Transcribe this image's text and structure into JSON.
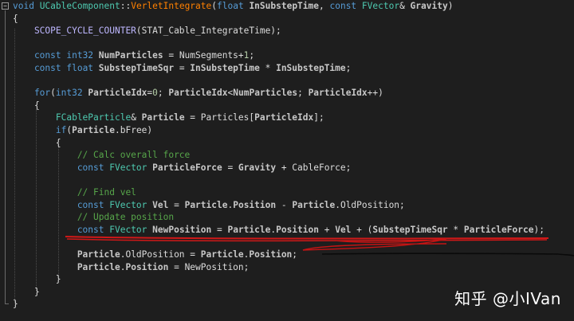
{
  "lines": [
    [
      {
        "t": "void ",
        "c": "kw"
      },
      {
        "t": "UCableComponent",
        "c": "ty"
      },
      {
        "t": "::",
        "c": "pl"
      },
      {
        "t": "VerletIntegrate",
        "c": "fn"
      },
      {
        "t": "(",
        "c": "pl"
      },
      {
        "t": "float ",
        "c": "kw"
      },
      {
        "t": "InSubstepTime",
        "c": "b"
      },
      {
        "t": ", ",
        "c": "pl"
      },
      {
        "t": "const ",
        "c": "kw"
      },
      {
        "t": "FVector",
        "c": "ty"
      },
      {
        "t": "& ",
        "c": "pl"
      },
      {
        "t": "Gravity",
        "c": "b"
      },
      {
        "t": ")",
        "c": "pl"
      }
    ],
    [
      {
        "t": "{",
        "c": "pl"
      }
    ],
    [
      {
        "t": "    SCOPE_CYCLE_COUNTER",
        "c": "mac"
      },
      {
        "t": "(STAT_Cable_IntegrateTime);",
        "c": "pl"
      }
    ],
    [],
    [
      {
        "t": "    const ",
        "c": "kw"
      },
      {
        "t": "int32 ",
        "c": "kw"
      },
      {
        "t": "NumParticles",
        "c": "b"
      },
      {
        "t": " = NumSegments+",
        "c": "pl"
      },
      {
        "t": "1",
        "c": "num"
      },
      {
        "t": ";",
        "c": "pl"
      }
    ],
    [
      {
        "t": "    const ",
        "c": "kw"
      },
      {
        "t": "float ",
        "c": "kw"
      },
      {
        "t": "SubstepTimeSqr",
        "c": "b"
      },
      {
        "t": " = ",
        "c": "pl"
      },
      {
        "t": "InSubstepTime",
        "c": "b"
      },
      {
        "t": " * ",
        "c": "pl"
      },
      {
        "t": "InSubstepTime",
        "c": "b"
      },
      {
        "t": ";",
        "c": "pl"
      }
    ],
    [],
    [
      {
        "t": "    for",
        "c": "kw"
      },
      {
        "t": "(",
        "c": "pl"
      },
      {
        "t": "int32 ",
        "c": "kw"
      },
      {
        "t": "ParticleIdx",
        "c": "b"
      },
      {
        "t": "=",
        "c": "pl"
      },
      {
        "t": "0",
        "c": "num"
      },
      {
        "t": "; ",
        "c": "pl"
      },
      {
        "t": "ParticleIdx",
        "c": "b"
      },
      {
        "t": "<",
        "c": "pl"
      },
      {
        "t": "NumParticles",
        "c": "b"
      },
      {
        "t": "; ",
        "c": "pl"
      },
      {
        "t": "ParticleIdx",
        "c": "b"
      },
      {
        "t": "++)",
        "c": "pl"
      }
    ],
    [
      {
        "t": "    {",
        "c": "pl"
      }
    ],
    [
      {
        "t": "        FCableParticle",
        "c": "ty"
      },
      {
        "t": "& ",
        "c": "pl"
      },
      {
        "t": "Particle",
        "c": "b"
      },
      {
        "t": " = Particles[",
        "c": "pl"
      },
      {
        "t": "ParticleIdx",
        "c": "b"
      },
      {
        "t": "];",
        "c": "pl"
      }
    ],
    [
      {
        "t": "        if",
        "c": "kw"
      },
      {
        "t": "(",
        "c": "pl"
      },
      {
        "t": "Particle",
        "c": "b"
      },
      {
        "t": ".bFree)",
        "c": "pl"
      }
    ],
    [
      {
        "t": "        {",
        "c": "pl"
      }
    ],
    [
      {
        "t": "            // Calc overall force",
        "c": "cm"
      }
    ],
    [
      {
        "t": "            const ",
        "c": "kw"
      },
      {
        "t": "FVector ",
        "c": "ty"
      },
      {
        "t": "ParticleForce",
        "c": "b"
      },
      {
        "t": " = ",
        "c": "pl"
      },
      {
        "t": "Gravity",
        "c": "b"
      },
      {
        "t": " + CableForce;",
        "c": "pl"
      }
    ],
    [],
    [
      {
        "t": "            // Find vel",
        "c": "cm"
      }
    ],
    [
      {
        "t": "            const ",
        "c": "kw"
      },
      {
        "t": "FVector ",
        "c": "ty"
      },
      {
        "t": "Vel",
        "c": "b"
      },
      {
        "t": " = ",
        "c": "pl"
      },
      {
        "t": "Particle",
        "c": "b"
      },
      {
        "t": ".",
        "c": "pl"
      },
      {
        "t": "Position",
        "c": "b"
      },
      {
        "t": " - ",
        "c": "pl"
      },
      {
        "t": "Particle",
        "c": "b"
      },
      {
        "t": ".OldPosition;",
        "c": "pl"
      }
    ],
    [
      {
        "t": "            // Update position",
        "c": "cm"
      }
    ],
    [
      {
        "t": "            const ",
        "c": "kw"
      },
      {
        "t": "FVector ",
        "c": "ty"
      },
      {
        "t": "NewPosition",
        "c": "b"
      },
      {
        "t": " = ",
        "c": "pl"
      },
      {
        "t": "Particle",
        "c": "b"
      },
      {
        "t": ".",
        "c": "pl"
      },
      {
        "t": "Position",
        "c": "b"
      },
      {
        "t": " + ",
        "c": "pl"
      },
      {
        "t": "Vel",
        "c": "b"
      },
      {
        "t": " + (",
        "c": "pl"
      },
      {
        "t": "SubstepTimeSqr",
        "c": "b"
      },
      {
        "t": " * ",
        "c": "pl"
      },
      {
        "t": "ParticleForce",
        "c": "b"
      },
      {
        "t": ");",
        "c": "pl"
      }
    ],
    [],
    [
      {
        "t": "            Particle",
        "c": "b"
      },
      {
        "t": ".OldPosition = ",
        "c": "pl"
      },
      {
        "t": "Particle",
        "c": "b"
      },
      {
        "t": ".",
        "c": "pl"
      },
      {
        "t": "Position",
        "c": "b"
      },
      {
        "t": ";",
        "c": "pl"
      }
    ],
    [
      {
        "t": "            Particle",
        "c": "b"
      },
      {
        "t": ".",
        "c": "pl"
      },
      {
        "t": "Position",
        "c": "b"
      },
      {
        "t": " = NewPosition;",
        "c": "pl"
      }
    ],
    [
      {
        "t": "        }",
        "c": "pl"
      }
    ],
    [
      {
        "t": "    }",
        "c": "pl"
      }
    ],
    [
      {
        "t": "}",
        "c": "pl"
      }
    ]
  ],
  "watermark": "知乎 @小IVan",
  "colors": {
    "background": "#1e1e1e",
    "keyword": "#569cd6",
    "type": "#4ec9b0",
    "function": "#ff8000",
    "macro": "#beb7ff",
    "comment": "#57a64a",
    "number": "#b5cea8",
    "annotation_red": "#d01818",
    "annotation_black": "#0a0a0a"
  },
  "icons": [
    "fold-collapse-icon"
  ]
}
